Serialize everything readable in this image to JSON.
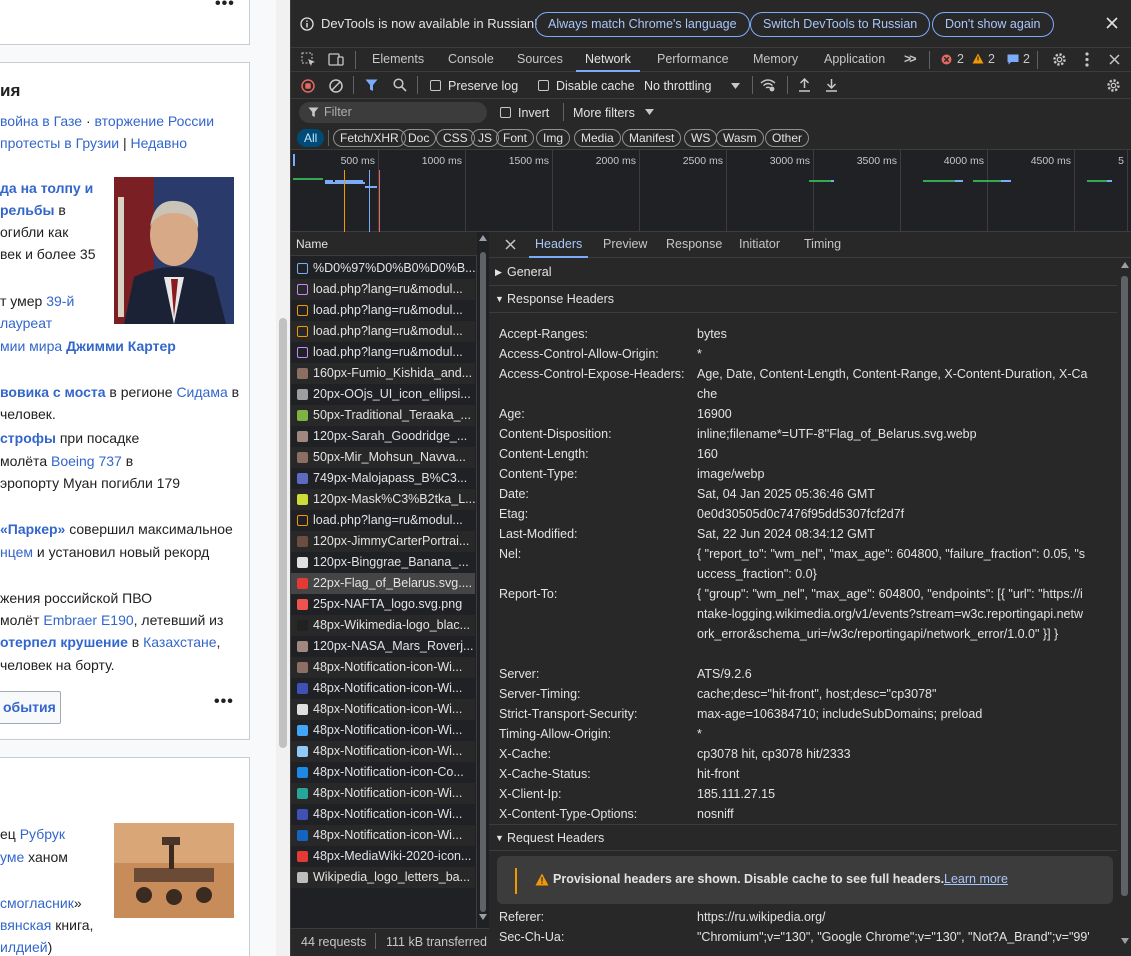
{
  "wiki": {
    "lines": [
      {
        "parts": [
          {
            "t": "ия",
            "b": true
          }
        ]
      },
      {
        "parts": [
          {
            "t": "война в Газе",
            "l": true
          },
          {
            "t": " · "
          },
          {
            "t": "вторжение России",
            "l": true
          }
        ]
      },
      {
        "parts": [
          {
            "t": " протесты в Грузии",
            "l": true
          },
          {
            "t": " | "
          },
          {
            "t": "Недавно",
            "l": true
          }
        ]
      },
      {
        "parts": [
          {
            "t": "да на толпу и",
            "l": true,
            "b": true
          }
        ]
      },
      {
        "parts": [
          {
            "t": "рельбы",
            "l": true,
            "b": true
          },
          {
            "t": " в"
          }
        ]
      },
      {
        "parts": [
          {
            "t": "огибли как"
          }
        ]
      },
      {
        "parts": [
          {
            "t": "век и более 35"
          }
        ]
      },
      {
        "parts": [
          {
            "t": "т умер "
          },
          {
            "t": "39-й",
            "l": true
          }
        ]
      },
      {
        "parts": [
          {
            "t": " лауреат",
            "l": true
          }
        ]
      },
      {
        "parts": [
          {
            "t": "мии мира",
            "l": true
          },
          {
            "t": " "
          },
          {
            "t": "Джимми Картер",
            "l": true,
            "b": true
          }
        ]
      },
      {
        "parts": [
          {
            "t": "вовика с моста",
            "l": true,
            "b": true
          },
          {
            "t": " в регионе "
          },
          {
            "t": "Сидама",
            "l": true
          },
          {
            "t": " в"
          }
        ]
      },
      {
        "parts": [
          {
            "t": " человек."
          }
        ]
      },
      {
        "parts": [
          {
            "t": "строфы",
            "l": true,
            "b": true
          },
          {
            "t": " при посадке"
          }
        ]
      },
      {
        "parts": [
          {
            "t": "молёта "
          },
          {
            "t": "Boeing 737",
            "l": true
          },
          {
            "t": " в"
          }
        ]
      },
      {
        "parts": [
          {
            "t": "эропорту Муан погибли 179"
          }
        ]
      },
      {
        "parts": [
          {
            "t": "«Паркер»",
            "l": true,
            "b": true
          },
          {
            "t": " совершил максимальное"
          }
        ]
      },
      {
        "parts": [
          {
            "t": "нцем",
            "l": true
          },
          {
            "t": " и установил новый рекорд"
          }
        ]
      },
      {
        "parts": [
          {
            "t": "жения российской ПВО"
          }
        ]
      },
      {
        "parts": [
          {
            "t": "молёт "
          },
          {
            "t": "Embraer E190",
            "l": true
          },
          {
            "t": ", летевший из"
          }
        ]
      },
      {
        "parts": [
          {
            "t": "отерпел крушение",
            "l": true,
            "b": true
          },
          {
            "t": " в "
          },
          {
            "t": "Казахстане",
            "l": true
          },
          {
            "t": ","
          }
        ]
      },
      {
        "parts": [
          {
            "t": "человек на борту."
          }
        ]
      },
      {
        "parts": [
          {
            "t": "ец "
          },
          {
            "t": "Рубрук",
            "l": true
          }
        ]
      },
      {
        "parts": [
          {
            "t": "уме",
            "l": true
          },
          {
            "t": " ханом"
          }
        ]
      },
      {
        "parts": [
          {
            "t": "смогласник",
            "l": true
          },
          {
            "t": "»"
          }
        ]
      },
      {
        "parts": [
          {
            "t": "вянская",
            "l": true
          },
          {
            "t": " книга,"
          }
        ]
      },
      {
        "parts": [
          {
            "t": "илдией",
            "l": true
          },
          {
            "t": ")"
          }
        ]
      }
    ],
    "events_button": "обытия"
  },
  "devtools": {
    "infobar": {
      "message": "DevTools is now available in Russian!",
      "btn_match": "Always match Chrome's language",
      "btn_switch": "Switch DevTools to Russian",
      "btn_dismiss": "Don't show again"
    },
    "tabs": [
      "Elements",
      "Console",
      "Sources",
      "Network",
      "Performance",
      "Memory",
      "Application"
    ],
    "active_tab": "Network",
    "errors": "2",
    "warnings": "2",
    "messages": "2",
    "toolbar": {
      "preserve_log": "Preserve log",
      "disable_cache": "Disable cache",
      "throttling": "No throttling"
    },
    "filter": {
      "placeholder": "Filter",
      "invert": "Invert",
      "more_filters": "More filters"
    },
    "types": [
      "All",
      "Fetch/XHR",
      "Doc",
      "CSS",
      "JS",
      "Font",
      "Img",
      "Media",
      "Manifest",
      "WS",
      "Wasm",
      "Other"
    ],
    "timeline_ticks": [
      "500 ms",
      "1000 ms",
      "1500 ms",
      "2000 ms",
      "2500 ms",
      "3000 ms",
      "3500 ms",
      "4000 ms",
      "4500 ms",
      "5"
    ],
    "name_header": "Name",
    "requests": [
      {
        "name": "%D0%97%D0%B0%D0%B...",
        "icon": "doc",
        "color": "#7cacf8"
      },
      {
        "name": "load.php?lang=ru&modul...",
        "icon": "css",
        "color": "#c58af9"
      },
      {
        "name": "load.php?lang=ru&modul...",
        "icon": "js",
        "color": "#f29900"
      },
      {
        "name": "load.php?lang=ru&modul...",
        "icon": "js",
        "color": "#f29900"
      },
      {
        "name": "load.php?lang=ru&modul...",
        "icon": "css",
        "color": "#c58af9"
      },
      {
        "name": "160px-Fumio_Kishida_and...",
        "icon": "img",
        "color": "#8d6e63"
      },
      {
        "name": "20px-OOjs_UI_icon_ellipsi...",
        "icon": "img",
        "color": "#9e9e9e"
      },
      {
        "name": "50px-Traditional_Teraaka_...",
        "icon": "img",
        "color": "#7cb342"
      },
      {
        "name": "120px-Sarah_Goodridge_...",
        "icon": "img",
        "color": "#a1887f"
      },
      {
        "name": "50px-Mir_Mohsun_Navva...",
        "icon": "img",
        "color": "#8d6e63"
      },
      {
        "name": "749px-Malojapass_B%C3...",
        "icon": "img",
        "color": "#5c6bc0"
      },
      {
        "name": "120px-Mask%C3%B2tka_L...",
        "icon": "img",
        "color": "#cddc39"
      },
      {
        "name": "load.php?lang=ru&modul...",
        "icon": "js",
        "color": "#f29900"
      },
      {
        "name": "120px-JimmyCarterPortrai...",
        "icon": "img",
        "color": "#6d4c41"
      },
      {
        "name": "120px-Binggrae_Banana_...",
        "icon": "img",
        "color": "#e0e0e0"
      },
      {
        "name": "22px-Flag_of_Belarus.svg....",
        "icon": "img",
        "color": "#e53935"
      },
      {
        "name": "25px-NAFTA_logo.svg.png",
        "icon": "img",
        "color": "#ef5350"
      },
      {
        "name": "48px-Wikimedia-logo_blac...",
        "icon": "img",
        "color": "#212121"
      },
      {
        "name": "120px-NASA_Mars_Roverj...",
        "icon": "img",
        "color": "#a1887f"
      },
      {
        "name": "48px-Notification-icon-Wi...",
        "icon": "img",
        "color": "#8d6e63"
      },
      {
        "name": "48px-Notification-icon-Wi...",
        "icon": "img",
        "color": "#3f51b5"
      },
      {
        "name": "48px-Notification-icon-Wi...",
        "icon": "img",
        "color": "#e0e0e0"
      },
      {
        "name": "48px-Notification-icon-Wi...",
        "icon": "img",
        "color": "#42a5f5"
      },
      {
        "name": "48px-Notification-icon-Wi...",
        "icon": "img",
        "color": "#90caf9"
      },
      {
        "name": "48px-Notification-icon-Co...",
        "icon": "img",
        "color": "#1e88e5"
      },
      {
        "name": "48px-Notification-icon-Wi...",
        "icon": "img",
        "color": "#26a69a"
      },
      {
        "name": "48px-Notification-icon-Wi...",
        "icon": "img",
        "color": "#3f51b5"
      },
      {
        "name": "48px-Notification-icon-Wi...",
        "icon": "img",
        "color": "#1565c0"
      },
      {
        "name": "48px-MediaWiki-2020-icon...",
        "icon": "img",
        "color": "#e53935"
      },
      {
        "name": "Wikipedia_logo_letters_ba...",
        "icon": "img",
        "color": "#bdbdbd"
      }
    ],
    "selected_request": 15,
    "status": {
      "requests": "44 requests",
      "transferred": "111 kB transferred"
    },
    "detail_tabs": [
      "Headers",
      "Preview",
      "Response",
      "Initiator",
      "Timing"
    ],
    "active_detail_tab": "Headers",
    "sections": {
      "general": "General",
      "response": "Response Headers",
      "request": "Request Headers"
    },
    "response_headers": [
      {
        "k": "Accept-Ranges:",
        "v": "bytes"
      },
      {
        "k": "Access-Control-Allow-Origin:",
        "v": "*"
      },
      {
        "k": "Access-Control-Expose-Headers:",
        "v": "Age, Date, Content-Length, Content-Range, X-Content-Duration, X-Cache"
      },
      {
        "k": "Age:",
        "v": "16900"
      },
      {
        "k": "Content-Disposition:",
        "v": "inline;filename*=UTF-8''Flag_of_Belarus.svg.webp"
      },
      {
        "k": "Content-Length:",
        "v": "160"
      },
      {
        "k": "Content-Type:",
        "v": "image/webp"
      },
      {
        "k": "Date:",
        "v": "Sat, 04 Jan 2025 05:36:46 GMT"
      },
      {
        "k": "Etag:",
        "v": "0e0d30505d0c7476f95dd5307fcf2d7f"
      },
      {
        "k": "Last-Modified:",
        "v": "Sat, 22 Jun 2024 08:34:12 GMT"
      },
      {
        "k": "Nel:",
        "v": "{ \"report_to\": \"wm_nel\", \"max_age\": 604800, \"failure_fraction\": 0.05, \"success_fraction\": 0.0}"
      },
      {
        "k": "Report-To:",
        "v": "{ \"group\": \"wm_nel\", \"max_age\": 604800, \"endpoints\": [{ \"url\": \"https://intake-logging.wikimedia.org/v1/events?stream=w3c.reportingapi.network_error&schema_uri=/w3c/reportingapi/network_error/1.0.0\" }] }"
      },
      {
        "k": "Server:",
        "v": "ATS/9.2.6"
      },
      {
        "k": "Server-Timing:",
        "v": "cache;desc=\"hit-front\", host;desc=\"cp3078\""
      },
      {
        "k": "Strict-Transport-Security:",
        "v": "max-age=106384710; includeSubDomains; preload"
      },
      {
        "k": "Timing-Allow-Origin:",
        "v": "*"
      },
      {
        "k": "X-Cache:",
        "v": "cp3078 hit, cp3078 hit/2333"
      },
      {
        "k": "X-Cache-Status:",
        "v": "hit-front"
      },
      {
        "k": "X-Client-Ip:",
        "v": "185.111.27.15"
      },
      {
        "k": "X-Content-Type-Options:",
        "v": "nosniff"
      }
    ],
    "warning": {
      "text": "Provisional headers are shown. Disable cache to see full headers.",
      "link": "Learn more"
    },
    "request_headers": [
      {
        "k": "Referer:",
        "v": "https://ru.wikipedia.org/"
      },
      {
        "k": "Sec-Ch-Ua:",
        "v": "\"Chromium\";v=\"130\", \"Google Chrome\";v=\"130\", \"Not?A_Brand\";v=\"99\""
      }
    ],
    "colors": {
      "accent": "#7cacf8",
      "error": "#e46962",
      "warning": "#fdd663",
      "info": "#7cacf8"
    }
  }
}
